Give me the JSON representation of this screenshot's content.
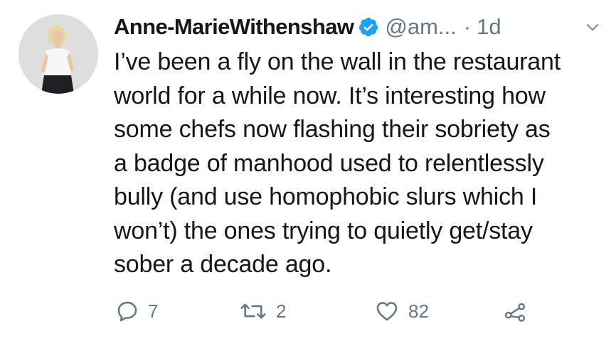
{
  "tweet": {
    "display_name": "Anne-MarieWithenshaw",
    "handle": "@am...",
    "separator": "·",
    "time": "1d",
    "body_lines": [
      "I’ve been a fly on the wall in the restaurant",
      "world for a while now. It’s interesting how",
      "some chefs now flashing their sobriety as",
      "a badge of manhood used to relentlessly",
      "bully (and use homophobic slurs which I",
      "won’t) the ones trying to quietly get/stay",
      "sober a decade ago."
    ],
    "actions": {
      "reply_count": "7",
      "retweet_count": "2",
      "like_count": "82"
    }
  },
  "icons": {
    "verified": "verified-badge-icon",
    "caret": "chevron-down-icon",
    "reply": "reply-icon",
    "retweet": "retweet-icon",
    "like": "heart-icon",
    "share": "share-icon"
  },
  "colors": {
    "text": "#14171a",
    "secondary": "#657786",
    "verified_blue": "#1da1f2"
  }
}
